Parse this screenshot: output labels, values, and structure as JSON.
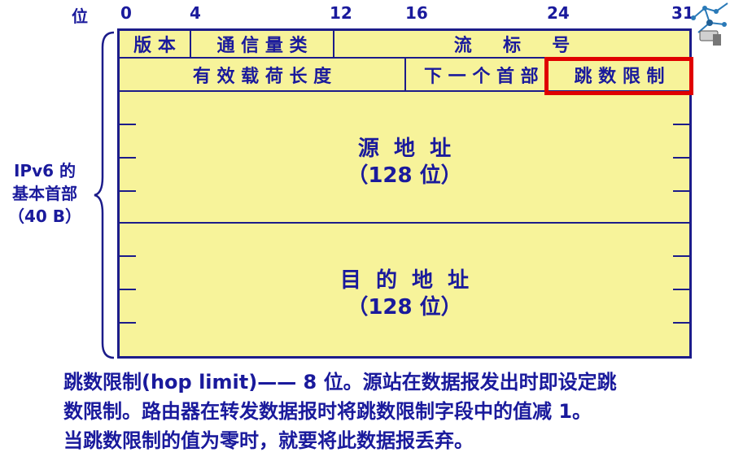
{
  "bit_ruler": {
    "label": "位",
    "ticks": [
      "0",
      "4",
      "12",
      "16",
      "24",
      "31"
    ]
  },
  "side_label": {
    "line1": "IPv6 的",
    "line2": "基本首部",
    "line3": "（40 B）"
  },
  "fields": {
    "version": "版 本",
    "traffic_class": "通 信 量 类",
    "flow_label": "流     标     号",
    "payload_length": "有 效 载 荷 长 度",
    "next_header": "下 一 个 首 部",
    "hop_limit": "跳 数 限 制",
    "source_address": "源  地  址",
    "source_bits": "（128 位）",
    "dest_address": "目  的  地  址",
    "dest_bits": "（128 位）"
  },
  "highlight_color": "#e00000",
  "description": {
    "line1": "跳数限制(hop limit)—— 8 位。源站在数据报发出时即设定跳",
    "line2": "数限制。路由器在转发数据报时将跳数限制字段中的值减 1。",
    "line3": "当跳数限制的值为零时，就要将此数据报丢弃。"
  }
}
